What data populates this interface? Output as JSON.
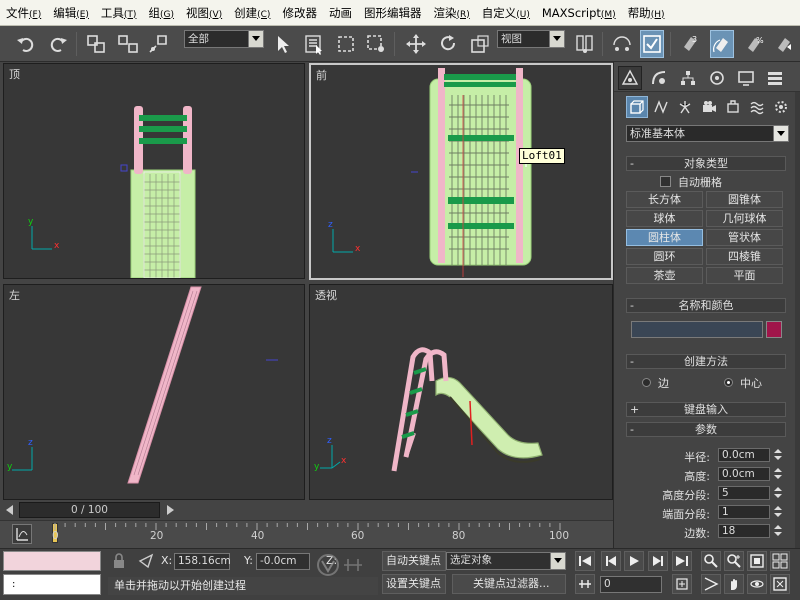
{
  "menu": [
    {
      "label": "文件",
      "key": "(F)"
    },
    {
      "label": "编辑",
      "key": "(E)"
    },
    {
      "label": "工具",
      "key": "(T)"
    },
    {
      "label": "组",
      "key": "(G)"
    },
    {
      "label": "视图",
      "key": "(V)"
    },
    {
      "label": "创建",
      "key": "(C)"
    },
    {
      "label": "修改器",
      "key": ""
    },
    {
      "label": "动画",
      "key": ""
    },
    {
      "label": "图形编辑器",
      "key": ""
    },
    {
      "label": "渲染",
      "key": "(R)"
    },
    {
      "label": "自定义",
      "key": "(U)"
    },
    {
      "label": "MAXScript",
      "key": "(M)"
    },
    {
      "label": "帮助",
      "key": "(H)"
    }
  ],
  "toolbar": {
    "selection_filter": "全部",
    "ref_coord": "视图"
  },
  "viewports": {
    "top": "顶",
    "front": "前",
    "left": "左",
    "perspective": "透视"
  },
  "axes": {
    "x": "x",
    "y": "y",
    "z": "z"
  },
  "tooltip": "Loft01",
  "command_panel": {
    "category": "标准基本体",
    "object_type_header": "对象类型",
    "autogrid_label": "自动栅格",
    "object_buttons": [
      "长方体",
      "圆锥体",
      "球体",
      "几何球体",
      "圆柱体",
      "管状体",
      "圆环",
      "四棱锥",
      "茶壶",
      "平面"
    ],
    "active_object": "圆柱体",
    "name_color_header": "名称和颜色",
    "object_color": "#a0154a",
    "creation_method_header": "创建方法",
    "creation_edge": "边",
    "creation_center": "中心",
    "creation_selected": "中心",
    "keyboard_entry_header": "键盘输入",
    "params_header": "参数",
    "params": [
      {
        "label": "半径:",
        "value": "0.0cm"
      },
      {
        "label": "高度:",
        "value": "0.0cm"
      },
      {
        "label": "高度分段:",
        "value": "5"
      },
      {
        "label": "端面分段:",
        "value": "1"
      },
      {
        "label": "边数:",
        "value": "18"
      }
    ]
  },
  "timeline": {
    "frame_display": "0 / 100",
    "ticks": [
      "0",
      "20",
      "40",
      "60",
      "80",
      "100"
    ]
  },
  "status": {
    "selection_count": ":",
    "x_label": "X:",
    "x_value": "158.16cm",
    "y_label": "Y:",
    "y_value": "-0.0cm",
    "z_label": "Z:",
    "auto_key": "自动关键点",
    "selected_objects": "选定对象",
    "set_key": "设置关键点",
    "key_filters": "关键点过滤器...",
    "frame": "0",
    "prompt": "单击并拖动以开始创建过程"
  }
}
